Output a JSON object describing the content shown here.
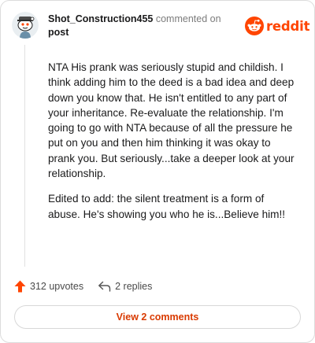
{
  "header": {
    "username": "Shot_Construction455",
    "action": "commented on",
    "target": "post",
    "brand_name": "reddit",
    "brand_color": "#ff4500"
  },
  "comment": {
    "paragraphs": [
      "NTA His prank was seriously stupid and childish. I think adding him to the deed is a bad idea and deep down you know that. He isn't entitled to any part of your inheritance. Re-evaluate the relationship. I'm going to go with NTA because of all the pressure he put on you and then him thinking it was okay to prank you. But seriously...take a deeper look at your relationship.",
      "Edited to add: the silent treatment is a form of abuse. He's showing you who he is...Believe him!!"
    ]
  },
  "actions": {
    "upvotes": "312 upvotes",
    "replies": "2 replies",
    "upvote_icon": "upvote-arrow-icon",
    "reply_icon": "reply-arrow-icon"
  },
  "footer": {
    "view_label": "View 2 comments",
    "link_color": "#d93a00"
  }
}
